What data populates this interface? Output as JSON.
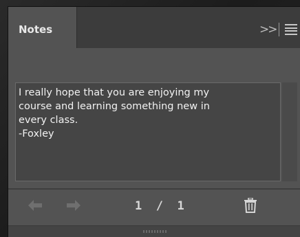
{
  "panel": {
    "tab_label": "Notes",
    "collapse_icon": "double-chevron-right-icon",
    "menu_icon": "hamburger-menu-icon"
  },
  "note": {
    "text": "I really hope that you are enjoying my\ncourse and learning something new in\nevery class.\n-Foxley"
  },
  "footer": {
    "prev_icon": "arrow-left-icon",
    "next_icon": "arrow-right-icon",
    "page_current": "1",
    "page_separator": "/",
    "page_total": "1",
    "delete_icon": "trash-icon"
  },
  "colors": {
    "panel_bg": "#535353",
    "tab_strip_bg": "#3c3c3c",
    "text_area_bg": "#454545",
    "text_color": "#f2f2f2"
  }
}
